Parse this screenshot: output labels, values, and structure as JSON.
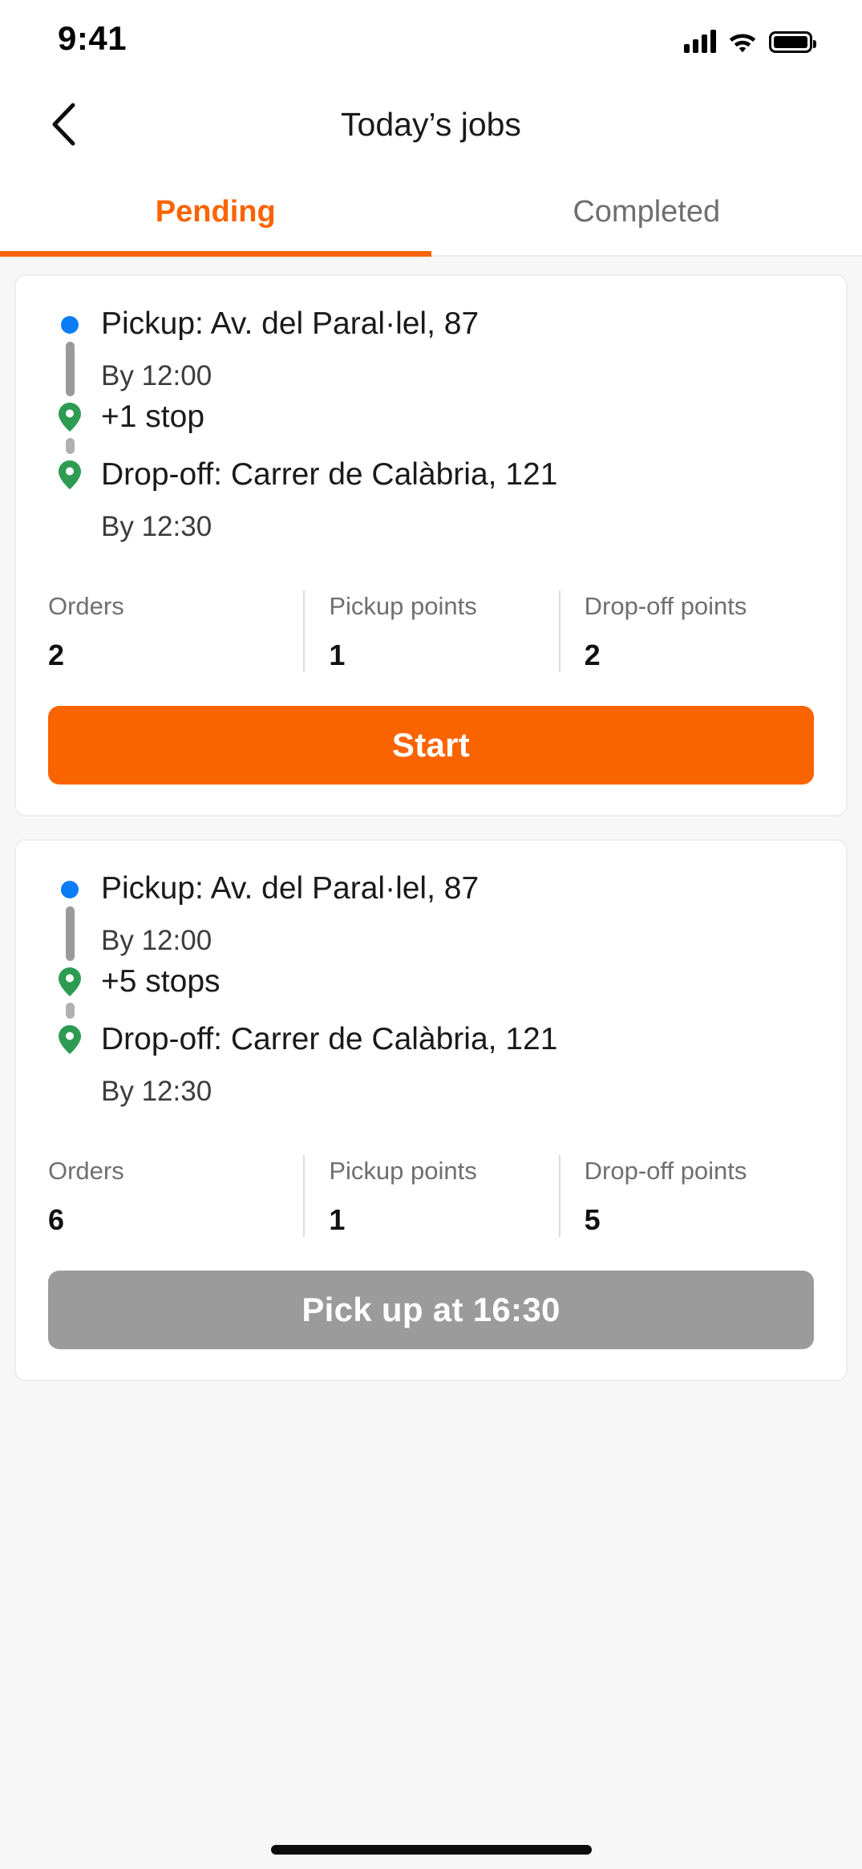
{
  "status_bar": {
    "time": "9:41",
    "cellular_icon": "signal-bars-icon",
    "wifi_icon": "wifi-icon",
    "battery_icon": "battery-full-icon"
  },
  "nav": {
    "back_icon": "chevron-left-icon",
    "title": "Today’s jobs"
  },
  "tabs": [
    {
      "label": "Pending",
      "active": true
    },
    {
      "label": "Completed",
      "active": false
    }
  ],
  "colors": {
    "accent": "#FA6400",
    "pickup_dot": "#0A7CF5",
    "stop_pin": "#2E9B53",
    "disabled_button": "#9B9B9B",
    "page_background": "#F7F7F7",
    "card_background": "#FFFFFF"
  },
  "jobs": [
    {
      "pickup": {
        "title": "Pickup: Av. del Paral·lel, 87",
        "time": "By 12:00",
        "marker": "pickup-dot-icon"
      },
      "stops": {
        "label": "+1 stop",
        "marker": "map-pin-icon"
      },
      "dropoff": {
        "title": "Drop-off: Carrer de Calàbria, 121",
        "time": "By 12:30",
        "marker": "map-pin-icon"
      },
      "stats": [
        {
          "label": "Orders",
          "value": "2"
        },
        {
          "label": "Pickup points",
          "value": "1"
        },
        {
          "label": "Drop-off points",
          "value": "2"
        }
      ],
      "action": {
        "label": "Start",
        "state": "primary"
      }
    },
    {
      "pickup": {
        "title": "Pickup: Av. del Paral·lel, 87",
        "time": "By 12:00",
        "marker": "pickup-dot-icon"
      },
      "stops": {
        "label": "+5 stops",
        "marker": "map-pin-icon"
      },
      "dropoff": {
        "title": "Drop-off: Carrer de Calàbria, 121",
        "time": "By 12:30",
        "marker": "map-pin-icon"
      },
      "stats": [
        {
          "label": "Orders",
          "value": "6"
        },
        {
          "label": "Pickup points",
          "value": "1"
        },
        {
          "label": "Drop-off points",
          "value": "5"
        }
      ],
      "action": {
        "label": "Pick up at 16:30",
        "state": "disabled"
      }
    }
  ]
}
